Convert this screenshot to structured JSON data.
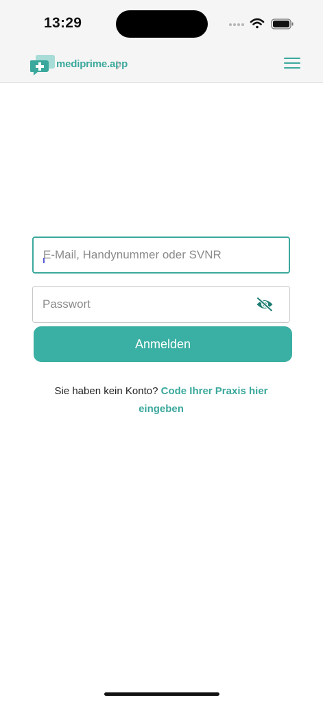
{
  "status_bar": {
    "time": "13:29",
    "icons": [
      "cellular-dots-icon",
      "wifi-icon",
      "battery-icon"
    ]
  },
  "header": {
    "logo_text": "mediprime.app",
    "menu_icon": "hamburger-menu-icon"
  },
  "login_form": {
    "identifier_placeholder": "E-Mail, Handynummer oder SVNR",
    "identifier_value": "",
    "password_placeholder": "Passwort",
    "password_value": "",
    "password_toggle_icon": "eye-slash-icon",
    "submit_label": "Anmelden"
  },
  "signup": {
    "prompt": "Sie haben kein Konto?",
    "link_label": "Code Ihrer Praxis hier eingeben"
  },
  "colors": {
    "accent": "#3aa89c",
    "button": "#3aafa3",
    "header_bg": "#f5f5f5"
  }
}
